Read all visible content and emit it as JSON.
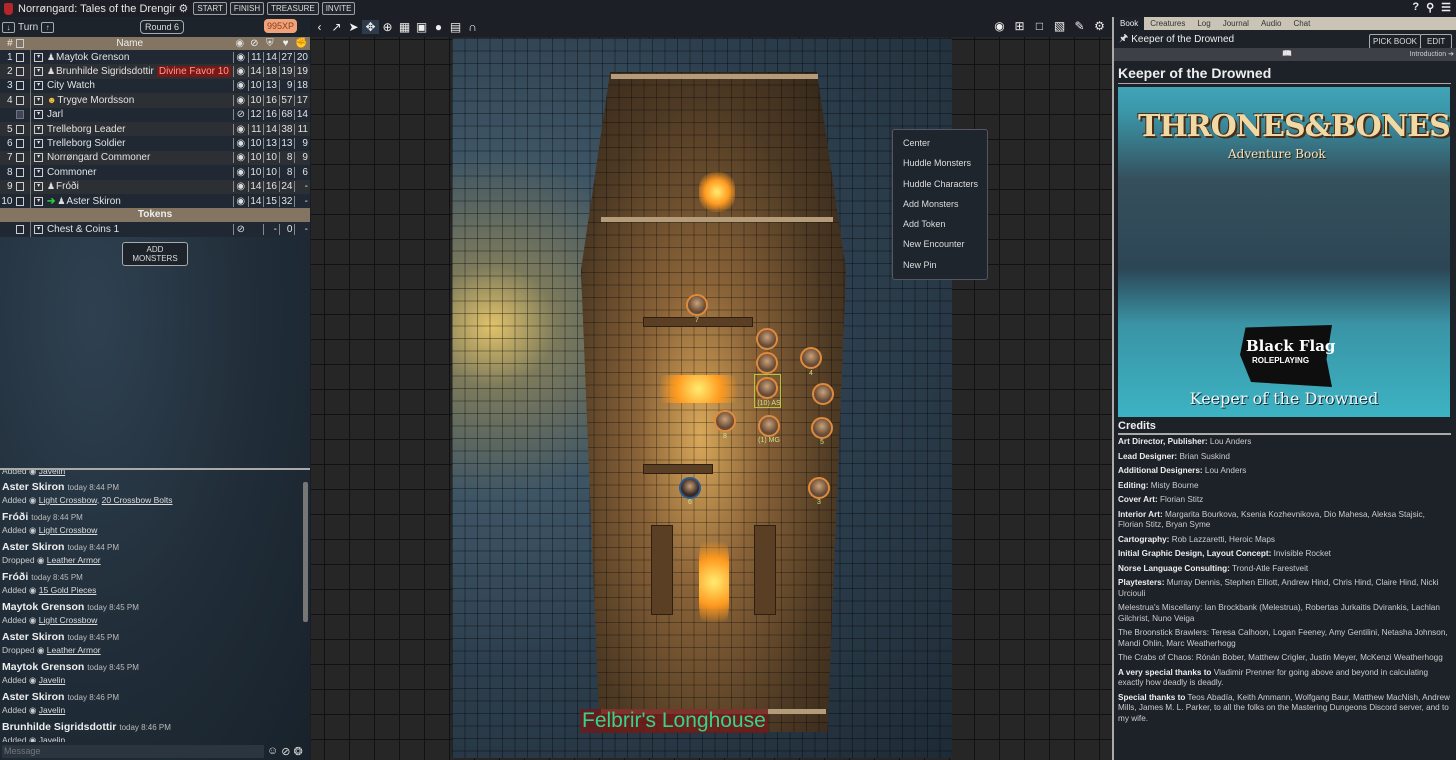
{
  "app": {
    "title": "Norrøngard: Tales of the Drengir",
    "buttons": [
      "START",
      "FINISH",
      "TREASURE",
      "INVITE"
    ],
    "top_right_icons": [
      "help-icon",
      "search-icon",
      "menu-icon"
    ]
  },
  "tracker": {
    "turn_label": "Turn",
    "round_label": "Round 6",
    "xp_label": "995XP",
    "columns": {
      "num": "#",
      "name": "Name"
    },
    "rows": [
      {
        "num": "1",
        "name": "Maytok Grenson",
        "pc": true,
        "vis": "visible",
        "v": [
          "11",
          "14",
          "27",
          "20"
        ]
      },
      {
        "num": "2",
        "name": "Brunhilde Sigridsdottir",
        "pc": true,
        "condition": "Divine Favor 10",
        "vis": "visible",
        "v": [
          "14",
          "18",
          "19",
          "19"
        ]
      },
      {
        "num": "3",
        "name": "City Watch",
        "vis": "visible",
        "v": [
          "10",
          "13",
          "9",
          "18"
        ]
      },
      {
        "num": "4",
        "name": "Trygve Mordsson",
        "smiley": true,
        "vis": "visible",
        "v": [
          "10",
          "16",
          "57",
          "17"
        ]
      },
      {
        "num": "",
        "name": "Jarl",
        "checked": true,
        "vis": "hidden",
        "v": [
          "12",
          "16",
          "68",
          "14"
        ]
      },
      {
        "num": "5",
        "name": "Trelleborg Leader",
        "vis": "visible",
        "v": [
          "11",
          "14",
          "38",
          "11"
        ]
      },
      {
        "num": "6",
        "name": "Trelleborg Soldier",
        "vis": "visible",
        "v": [
          "10",
          "13",
          "13",
          "9"
        ]
      },
      {
        "num": "7",
        "name": "Norrøngard Commoner",
        "vis": "visible",
        "v": [
          "10",
          "10",
          "8",
          "9"
        ]
      },
      {
        "num": "8",
        "name": "Commoner",
        "vis": "visible",
        "v": [
          "10",
          "10",
          "8",
          "6"
        ]
      },
      {
        "num": "9",
        "name": "Fróði",
        "pc": true,
        "vis": "visible",
        "v": [
          "14",
          "16",
          "24",
          "-"
        ]
      },
      {
        "num": "10",
        "name": "Aster Skiron",
        "pc": true,
        "current_turn": true,
        "vis": "visible",
        "v": [
          "14",
          "15",
          "32",
          "-"
        ]
      }
    ],
    "tokens_header": "Tokens",
    "tokens": [
      {
        "name": "Chest & Coins 1",
        "vis": "hidden",
        "v": [
          "",
          "-",
          "0",
          "-"
        ]
      }
    ],
    "add_monsters_label": "ADD MONSTERS"
  },
  "log": {
    "partial_top": {
      "action": "Added",
      "item": "Javelin"
    },
    "entries": [
      {
        "who": "Aster Skiron",
        "time": "today 8:44 PM",
        "action": "Added",
        "items": [
          "Light Crossbow",
          "20 Crossbow Bolts"
        ]
      },
      {
        "who": "Fróði",
        "time": "today 8:44 PM",
        "action": "Added",
        "items": [
          "Light Crossbow"
        ]
      },
      {
        "who": "Aster Skiron",
        "time": "today 8:44 PM",
        "action": "Dropped",
        "items": [
          "Leather Armor"
        ]
      },
      {
        "who": "Fróði",
        "time": "today 8:45 PM",
        "action": "Added",
        "items": [
          "15 Gold Pieces"
        ]
      },
      {
        "who": "Maytok Grenson",
        "time": "today 8:45 PM",
        "action": "Added",
        "items": [
          "Light Crossbow"
        ]
      },
      {
        "who": "Aster Skiron",
        "time": "today 8:45 PM",
        "action": "Dropped",
        "items": [
          "Leather Armor"
        ]
      },
      {
        "who": "Maytok Grenson",
        "time": "today 8:45 PM",
        "action": "Added",
        "items": [
          "Javelin"
        ]
      },
      {
        "who": "Aster Skiron",
        "time": "today 8:46 PM",
        "action": "Added",
        "items": [
          "Javelin"
        ]
      },
      {
        "who": "Brunhilde Sigridsdottir",
        "time": "today 8:46 PM",
        "action": "Added",
        "items": [
          "Javelin"
        ]
      }
    ],
    "message_placeholder": "Message"
  },
  "map": {
    "label": "Felbrir's Longhouse",
    "context_menu": [
      "Center",
      "Huddle Monsters",
      "Huddle Characters",
      "Add Monsters",
      "Add Token",
      "New Encounter",
      "New Pin"
    ],
    "token_labels": [
      "7",
      "4",
      "(10) AS",
      "8",
      "(1) MG",
      "5",
      "6",
      "3"
    ],
    "toolbar_left": [
      "collapse-icon",
      "share-icon",
      "pointer-icon",
      "move-icon",
      "zoom-icon",
      "grid-icon",
      "image-icon",
      "pin-icon",
      "scroll-icon",
      "magnet-icon"
    ],
    "toolbar_right": [
      "eye-icon",
      "crop-icon",
      "frame-icon",
      "paint-icon",
      "pencil-icon",
      "gear-icon"
    ]
  },
  "book": {
    "tabs": [
      "Book",
      "Creatures",
      "Log",
      "Journal",
      "Audio",
      "Chat"
    ],
    "active_tab": "Book",
    "current_book": "Keeper of the Drowned",
    "pick_book_label": "PICK BOOK",
    "edit_label": "EDIT",
    "next_label": "Introduction",
    "page_title": "Keeper of the Drowned",
    "cover": {
      "title": "THRONES&BONES",
      "subtitle": "Adventure Book",
      "publisher_line1": "Black Flag",
      "publisher_line2": "ROLEPLAYING",
      "bottom": "Keeper of the Drowned"
    },
    "credits_heading": "Credits",
    "credits": [
      {
        "label": "Art Director, Publisher:",
        "text": "Lou Anders"
      },
      {
        "label": "Lead Designer:",
        "text": "Brian Suskind"
      },
      {
        "label": "Additional Designers:",
        "text": "Lou Anders"
      },
      {
        "label": "Editing:",
        "text": "Misty Bourne"
      },
      {
        "label": "Cover Art:",
        "text": "Florian Stitz"
      },
      {
        "label": "Interior Art:",
        "text": "Margarita Bourkova, Ksenia Kozhevnikova, Dio Mahesa, Aleksa Stajsic, Florian Stitz, Bryan Syme"
      },
      {
        "label": "Cartography:",
        "text": "Rob Lazzaretti, Heroic Maps"
      },
      {
        "label": "Initial Graphic Design, Layout Concept:",
        "text": "Invisible Rocket"
      },
      {
        "label": "Norse Language Consulting:",
        "text": "Trond-Atle Farestveit"
      },
      {
        "label": "Playtesters:",
        "text": "Murray Dennis, Stephen Elliott, Andrew Hind, Chris Hind, Claire Hind, Nicki Urciouli"
      },
      {
        "label": "",
        "text": "Melestrua's Miscellany: Ian Brockbank (Melestrua), Robertas Jurkaitis Dvirankis, Lachlan Gilchrist, Nuno Veiga"
      },
      {
        "label": "",
        "text": "The Broonstick Brawlers: Teresa Calhoon, Logan Feeney, Amy Gentilini, Netasha Johnson, Mandi Ohlin, Marc Weatherhogg"
      },
      {
        "label": "",
        "text": "The Crabs of Chaos: Rónán Bober, Matthew Crigler, Justin Meyer, McKenzi Weatherhogg"
      },
      {
        "label": "A very special thanks to",
        "text": "Vladimir Prenner for going above and beyond in calculating exactly how deadly is deadly."
      },
      {
        "label": "Special thanks to",
        "text": "Teos Abadía, Keith Ammann, Wolfgang Baur, Matthew MacNish, Andrew Mills, James M. L. Parker, to all the folks on the Mastering Dungeons Discord server, and to my wife."
      }
    ]
  },
  "colors": {
    "condition_bg": "#7a1717",
    "xp_badge": "#f0a37a",
    "map_label_text": "#35d48a",
    "header_bar": "#837562"
  }
}
